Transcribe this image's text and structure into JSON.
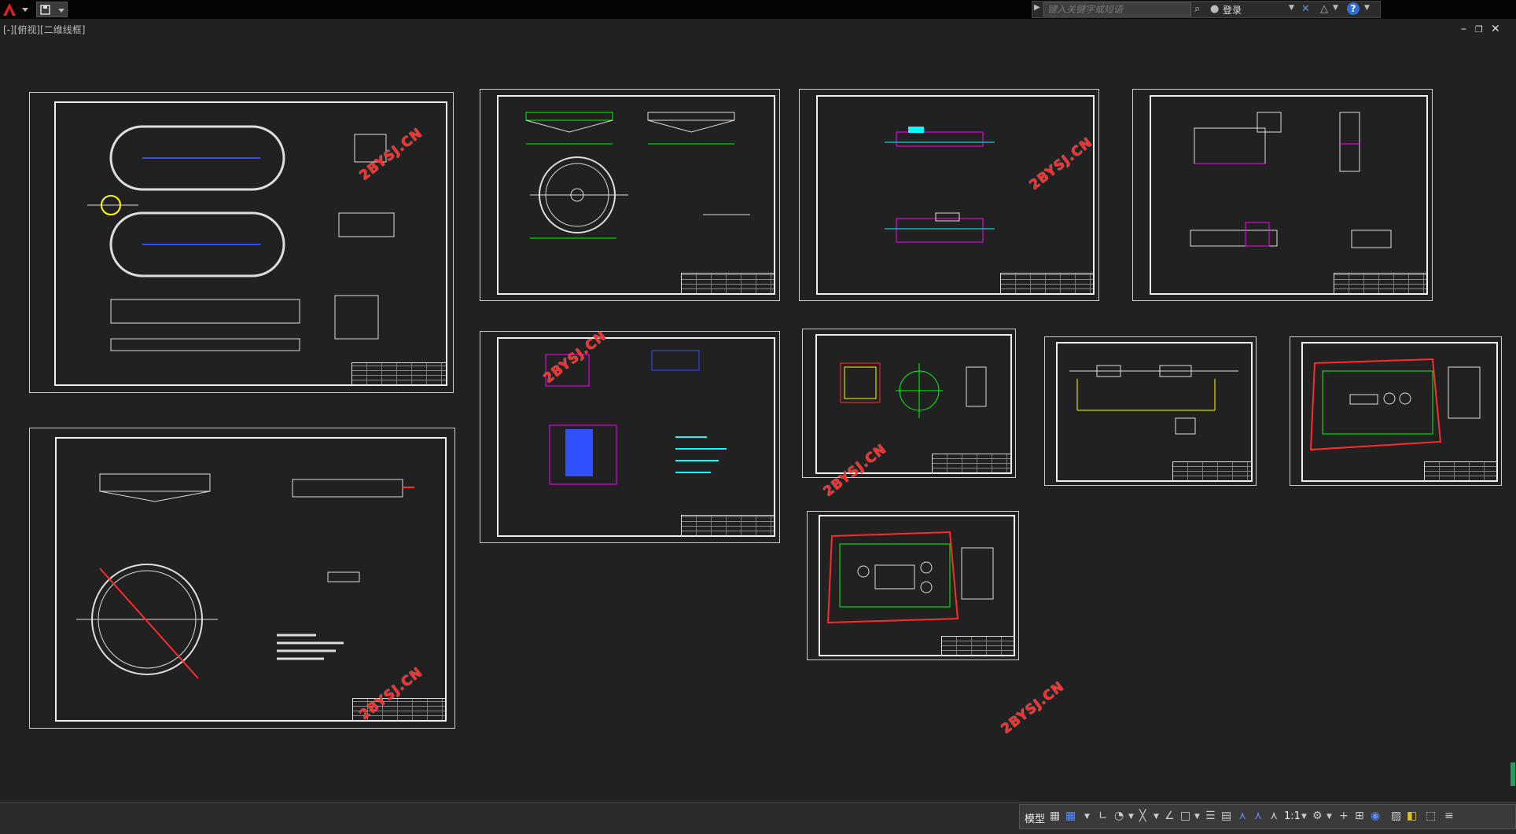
{
  "toolbar": {
    "search_placeholder": "键入关键字或短语",
    "login_label": "登录",
    "help_label": "?"
  },
  "viewport": {
    "label": "[-][俯视][二维线框]"
  },
  "watermarks": [
    "2BYSJ.CN",
    "2BYSJ.CN",
    "2BYSJ.CN",
    "2BYSJ.CN",
    "2BYSJ.CN",
    "2BYSJ.CN",
    "2BYSJ.CN",
    "2BYSJ.CN"
  ],
  "statusbar": {
    "model_tab": "模型",
    "scale": "1:1"
  },
  "icons": {
    "app": "autocad-logo-icon",
    "quick_access": "save-icon",
    "search": "binoculars-icon",
    "user": "user-icon",
    "exchange": "x-icon",
    "connect": "a360-icon",
    "help": "help-icon"
  },
  "colors": {
    "canvas": "#212121",
    "sheet_border": "#cfcfcf",
    "watermark": "#ff2a2a",
    "magenta": "#ff00ff",
    "cyan": "#00ffff",
    "green": "#00ff00",
    "yellow": "#ffff00",
    "blue": "#3050ff"
  }
}
